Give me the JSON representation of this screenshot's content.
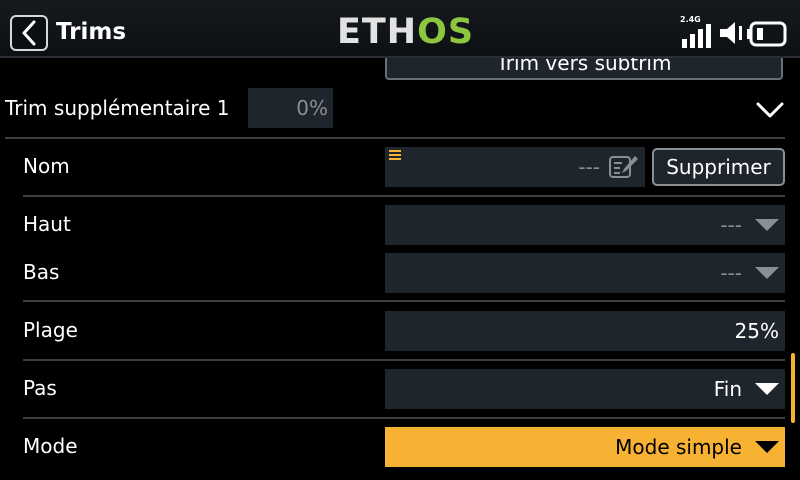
{
  "header": {
    "title": "Trims",
    "logo_main": "ETH",
    "logo_accent": "OS",
    "signal_label": "2.4G"
  },
  "top_button": {
    "label": "Trim vers subtrim"
  },
  "trim_section": {
    "label": "Trim supplémentaire 1",
    "value": "0%"
  },
  "rows": {
    "name": {
      "label": "Nom",
      "value": "---",
      "delete_label": "Supprimer"
    },
    "up": {
      "label": "Haut",
      "value": "---"
    },
    "down": {
      "label": "Bas",
      "value": "---"
    },
    "range": {
      "label": "Plage",
      "value": "25%"
    },
    "step": {
      "label": "Pas",
      "value": "Fin"
    },
    "mode": {
      "label": "Mode",
      "value": "Mode simple"
    }
  },
  "colors": {
    "accent": "#f7b133",
    "brand_green": "#8cc63f",
    "field_bg": "#1f252c",
    "background": "#000000"
  },
  "icons": [
    "back-arrow-icon",
    "signal-bars-icon",
    "speaker-icon",
    "battery-icon",
    "chevron-down-icon",
    "drag-handle-icon",
    "edit-icon",
    "dropdown-triangle-icon"
  ]
}
